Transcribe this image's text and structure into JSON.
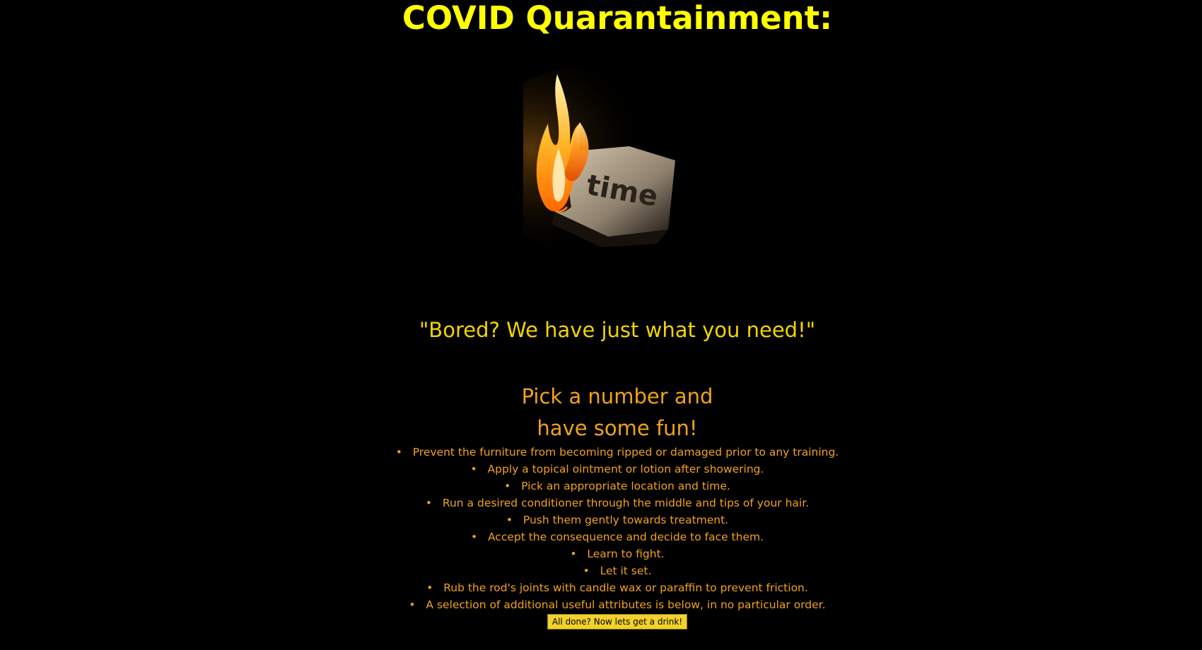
{
  "header": {
    "title": "COVID Quarantainment:"
  },
  "hero": {
    "image_icon": "burning-paper-image",
    "paper_word": "time"
  },
  "tagline": "\"Bored? We have just what you need!\"",
  "subhead": {
    "line1": "Pick a number and",
    "line2": "have some fun!"
  },
  "list": {
    "items": [
      "Prevent the furniture from becoming ripped or damaged prior to any training.",
      "Apply a topical ointment or lotion after showering.",
      "Pick an appropriate location and time.",
      "Run a desired conditioner through the middle and tips of your hair.",
      "Push them gently towards treatment.",
      "Accept the consequence and decide to face them.",
      "Learn to fight.",
      "Let it set.",
      "Rub the rod's joints with candle wax or paraffin to prevent friction.",
      "A selection of additional useful attributes is below, in no particular order."
    ]
  },
  "cta": {
    "label": "All done? Now lets get a drink!"
  },
  "colors": {
    "background": "#000000",
    "title": "#ffff00",
    "tagline": "#f2d400",
    "text": "#f0a21a",
    "button": "#f2d22a"
  }
}
